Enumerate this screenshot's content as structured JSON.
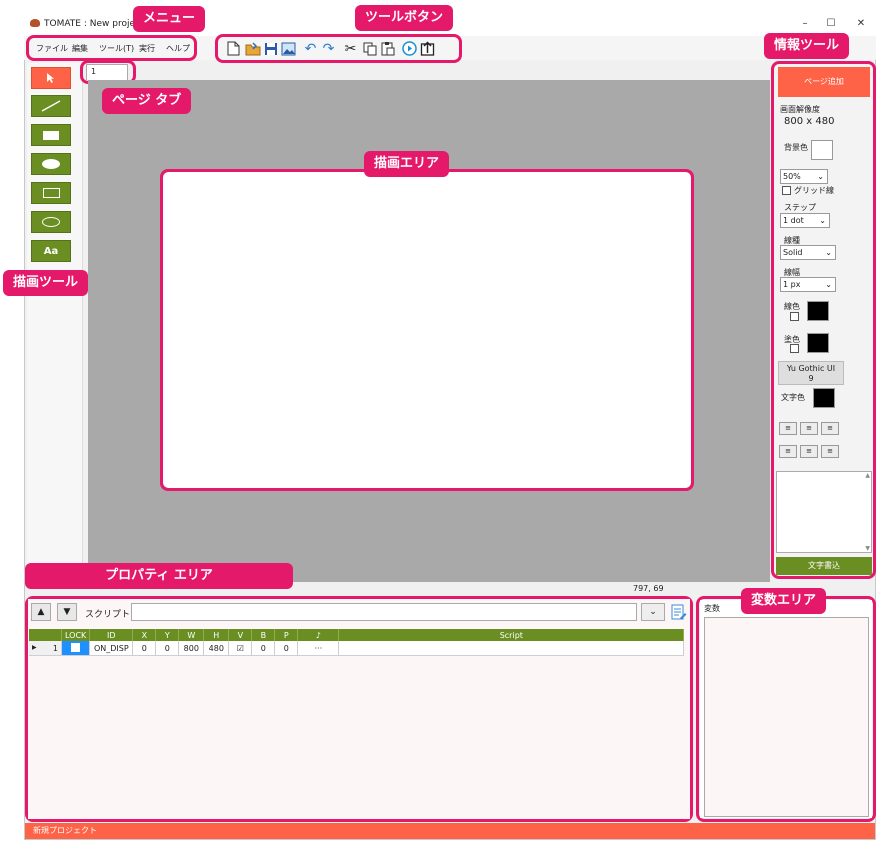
{
  "window": {
    "title": "TOMATE : New project",
    "minimize": "–",
    "maximize": "☐",
    "close": "✕"
  },
  "menu": [
    "ファイル",
    "編集",
    "ツール(T)",
    "実行",
    "ヘルプ"
  ],
  "toolbar_icons": [
    "new-file-icon",
    "open-folder-icon",
    "save-icon",
    "image-icon",
    "undo-icon",
    "redo-icon",
    "cut-icon",
    "copy-icon",
    "paste-icon",
    "run-icon",
    "export-icon"
  ],
  "annotations": {
    "menu": "メニュー",
    "tool_buttons": "ツールボタン",
    "info_tool": "情報ツール",
    "page_tab": "ページ タブ",
    "draw_area": "描画エリア",
    "draw_tool": "描画ツール",
    "property_area": "プロパティ エリア",
    "variable_area": "変数エリア"
  },
  "draw_tools": [
    "select-arrow",
    "line",
    "filled-rect",
    "filled-ellipse",
    "rect",
    "ellipse",
    "text"
  ],
  "text_tool_label": "Aa",
  "page_tab": "1",
  "info": {
    "add_page": "ページ追加",
    "resolution_label": "画面解像度",
    "resolution": "800 x 480",
    "bg_color_label": "背景色",
    "zoom": "50%",
    "grid_label": "グリッド線",
    "step_label": "ステップ",
    "step_value": "1 dot",
    "line_type_label": "線種",
    "line_type_value": "Solid",
    "line_width_label": "線幅",
    "line_width_value": "1 px",
    "line_color_label": "線色",
    "fill_color_label": "塗色",
    "font_button": "Yu Gothic UI",
    "font_size": "9",
    "text_color_label": "文字色",
    "write_text_button": "文字書込",
    "colors": {
      "bg": "#ffffff",
      "line": "#000000",
      "fill": "#000000",
      "text": "#000000"
    }
  },
  "coords": "797, 69",
  "properties": {
    "up": "▲",
    "down": "▼",
    "script_label": "スクリプト",
    "columns": [
      "",
      "LOCK",
      "ID",
      "X",
      "Y",
      "W",
      "H",
      "V",
      "B",
      "P",
      "♪",
      "Script"
    ],
    "rows": [
      {
        "num": "1",
        "id": "ON_DISP",
        "x": "0",
        "y": "0",
        "w": "800",
        "h": "480",
        "b": "0",
        "p": "0",
        "sound": "···"
      }
    ]
  },
  "variables": {
    "tab": "変数"
  },
  "status": "新規プロジェクト",
  "accent": "#e5196a",
  "brand_green": "#6b8e23",
  "brand_orange": "#ff6347"
}
